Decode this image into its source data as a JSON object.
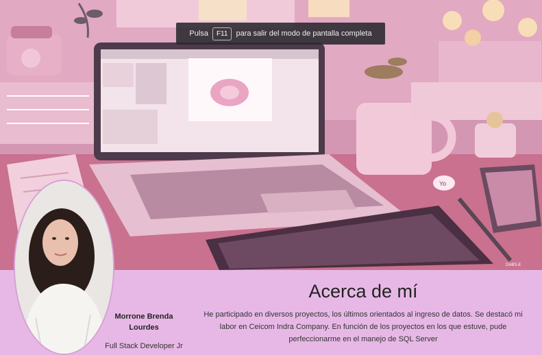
{
  "fullscreen_toast": {
    "prefix": "Pulsa",
    "key": "F11",
    "suffix": "para salir del modo de pantalla completa"
  },
  "profile": {
    "name_line1": "Morrone Brenda",
    "name_line2": "Lourdes",
    "role": "Full Stack Developer Jr"
  },
  "about": {
    "title": "Acerca de mí",
    "text": "He participado en diversos proyectos, los últimos orientados al ingreso de datos. Se destacó mi labor en Ceicom Indra Company. En función de los proyectos en los que estuve, pude perfeccionarme en el manejo de SQL Server"
  },
  "illustration": {
    "signature": "DABS-E",
    "speech_bubble": "Yo"
  },
  "colors": {
    "section_bg": "#e7b8e6",
    "toast_bg": "#28282d"
  }
}
